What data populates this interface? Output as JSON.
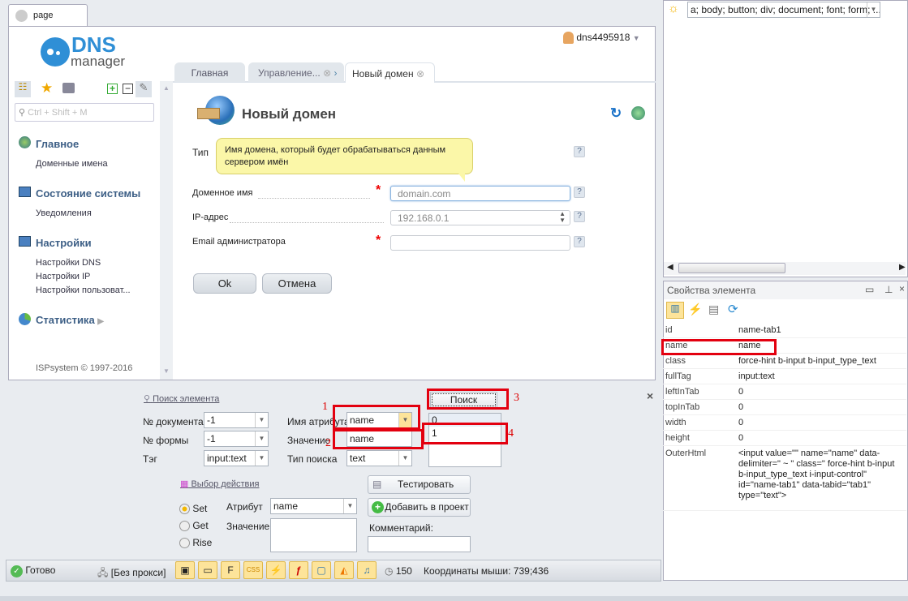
{
  "browser": {
    "tab_label": "page"
  },
  "app": {
    "logo": {
      "brand": "DNS",
      "sub": "manager"
    },
    "user": "dns4495918",
    "tabs": [
      {
        "label": "Главная"
      },
      {
        "label": "Управление..."
      },
      {
        "label": "Новый домен"
      }
    ],
    "sidebar": {
      "search_placeholder": "Ctrl + Shift + M",
      "sections": [
        {
          "title": "Главное",
          "items": [
            "Доменные имена"
          ]
        },
        {
          "title": "Состояние системы",
          "items": [
            "Уведомления"
          ]
        },
        {
          "title": "Настройки",
          "items": [
            "Настройки DNS",
            "Настройки IP",
            "Настройки пользоват..."
          ]
        },
        {
          "title": "Статистика",
          "items": []
        }
      ],
      "footer": "ISPsystem © 1997-2016"
    },
    "form": {
      "title": "Новый домен",
      "tooltip": "Имя домена, который будет обрабатываться данным сервером имён",
      "fields": [
        {
          "label": "Тип",
          "placeholder": ""
        },
        {
          "label": "Доменное имя",
          "placeholder": "domain.com"
        },
        {
          "label": "IP-адрес",
          "placeholder": "192.168.0.1"
        },
        {
          "label": "Email администратора",
          "placeholder": ""
        }
      ],
      "ok": "Ok",
      "cancel": "Отмена"
    }
  },
  "search_panel": {
    "title": "Поиск элемента",
    "doc_label": "№ документа",
    "doc_value": "-1",
    "form_label": "№ формы",
    "form_value": "-1",
    "tag_label": "Тэг",
    "tag_value": "input:text",
    "attr_label": "Имя атрибута",
    "attr_value": "name",
    "value_label": "Значение",
    "value_value": "name",
    "type_label": "Тип поиска",
    "type_value": "text",
    "search_button": "Поиск",
    "results": [
      "0",
      "1"
    ],
    "annotations": [
      "1",
      "2",
      "3",
      "4"
    ],
    "action_title": "Выбор действия",
    "radios": [
      {
        "label": "Set",
        "checked": true
      },
      {
        "label": "Get",
        "checked": false
      },
      {
        "label": "Rise",
        "checked": false
      }
    ],
    "action_attr_label": "Атрибут",
    "action_attr_value": "name",
    "action_value_label": "Значение",
    "test_button": "Тестировать",
    "add_button": "Добавить в проект",
    "comment_label": "Комментарий:"
  },
  "status": {
    "ready": "Готово",
    "proxy": "[Без прокси]",
    "timeout": "150",
    "coords": "Координаты мыши: 739;436"
  },
  "inspector": {
    "filter": "a; body; button; div; document; font; form; ...",
    "props_title": "Свойства элемента",
    "props": [
      {
        "k": "id",
        "v": "name-tab1"
      },
      {
        "k": "name",
        "v": "name"
      },
      {
        "k": "class",
        "v": " force-hint b-input b-input_type_text"
      },
      {
        "k": "fullTag",
        "v": "input:text"
      },
      {
        "k": "leftInTab",
        "v": "0"
      },
      {
        "k": "topInTab",
        "v": "0"
      },
      {
        "k": "width",
        "v": "0"
      },
      {
        "k": "height",
        "v": "0"
      },
      {
        "k": "OuterHtml",
        "v": "<input value=\"\" name=\"name\" data-delimiter=\" ~ \" class=\" force-hint b-input b-input_type_text i-input-control\" id=\"name-tab1\" data-tabid=\"tab1\" type=\"text\">"
      }
    ]
  },
  "colors": {
    "accent": "#3d5f86",
    "highlight": "#e3000f",
    "tooltip": "#fbf7a8"
  }
}
